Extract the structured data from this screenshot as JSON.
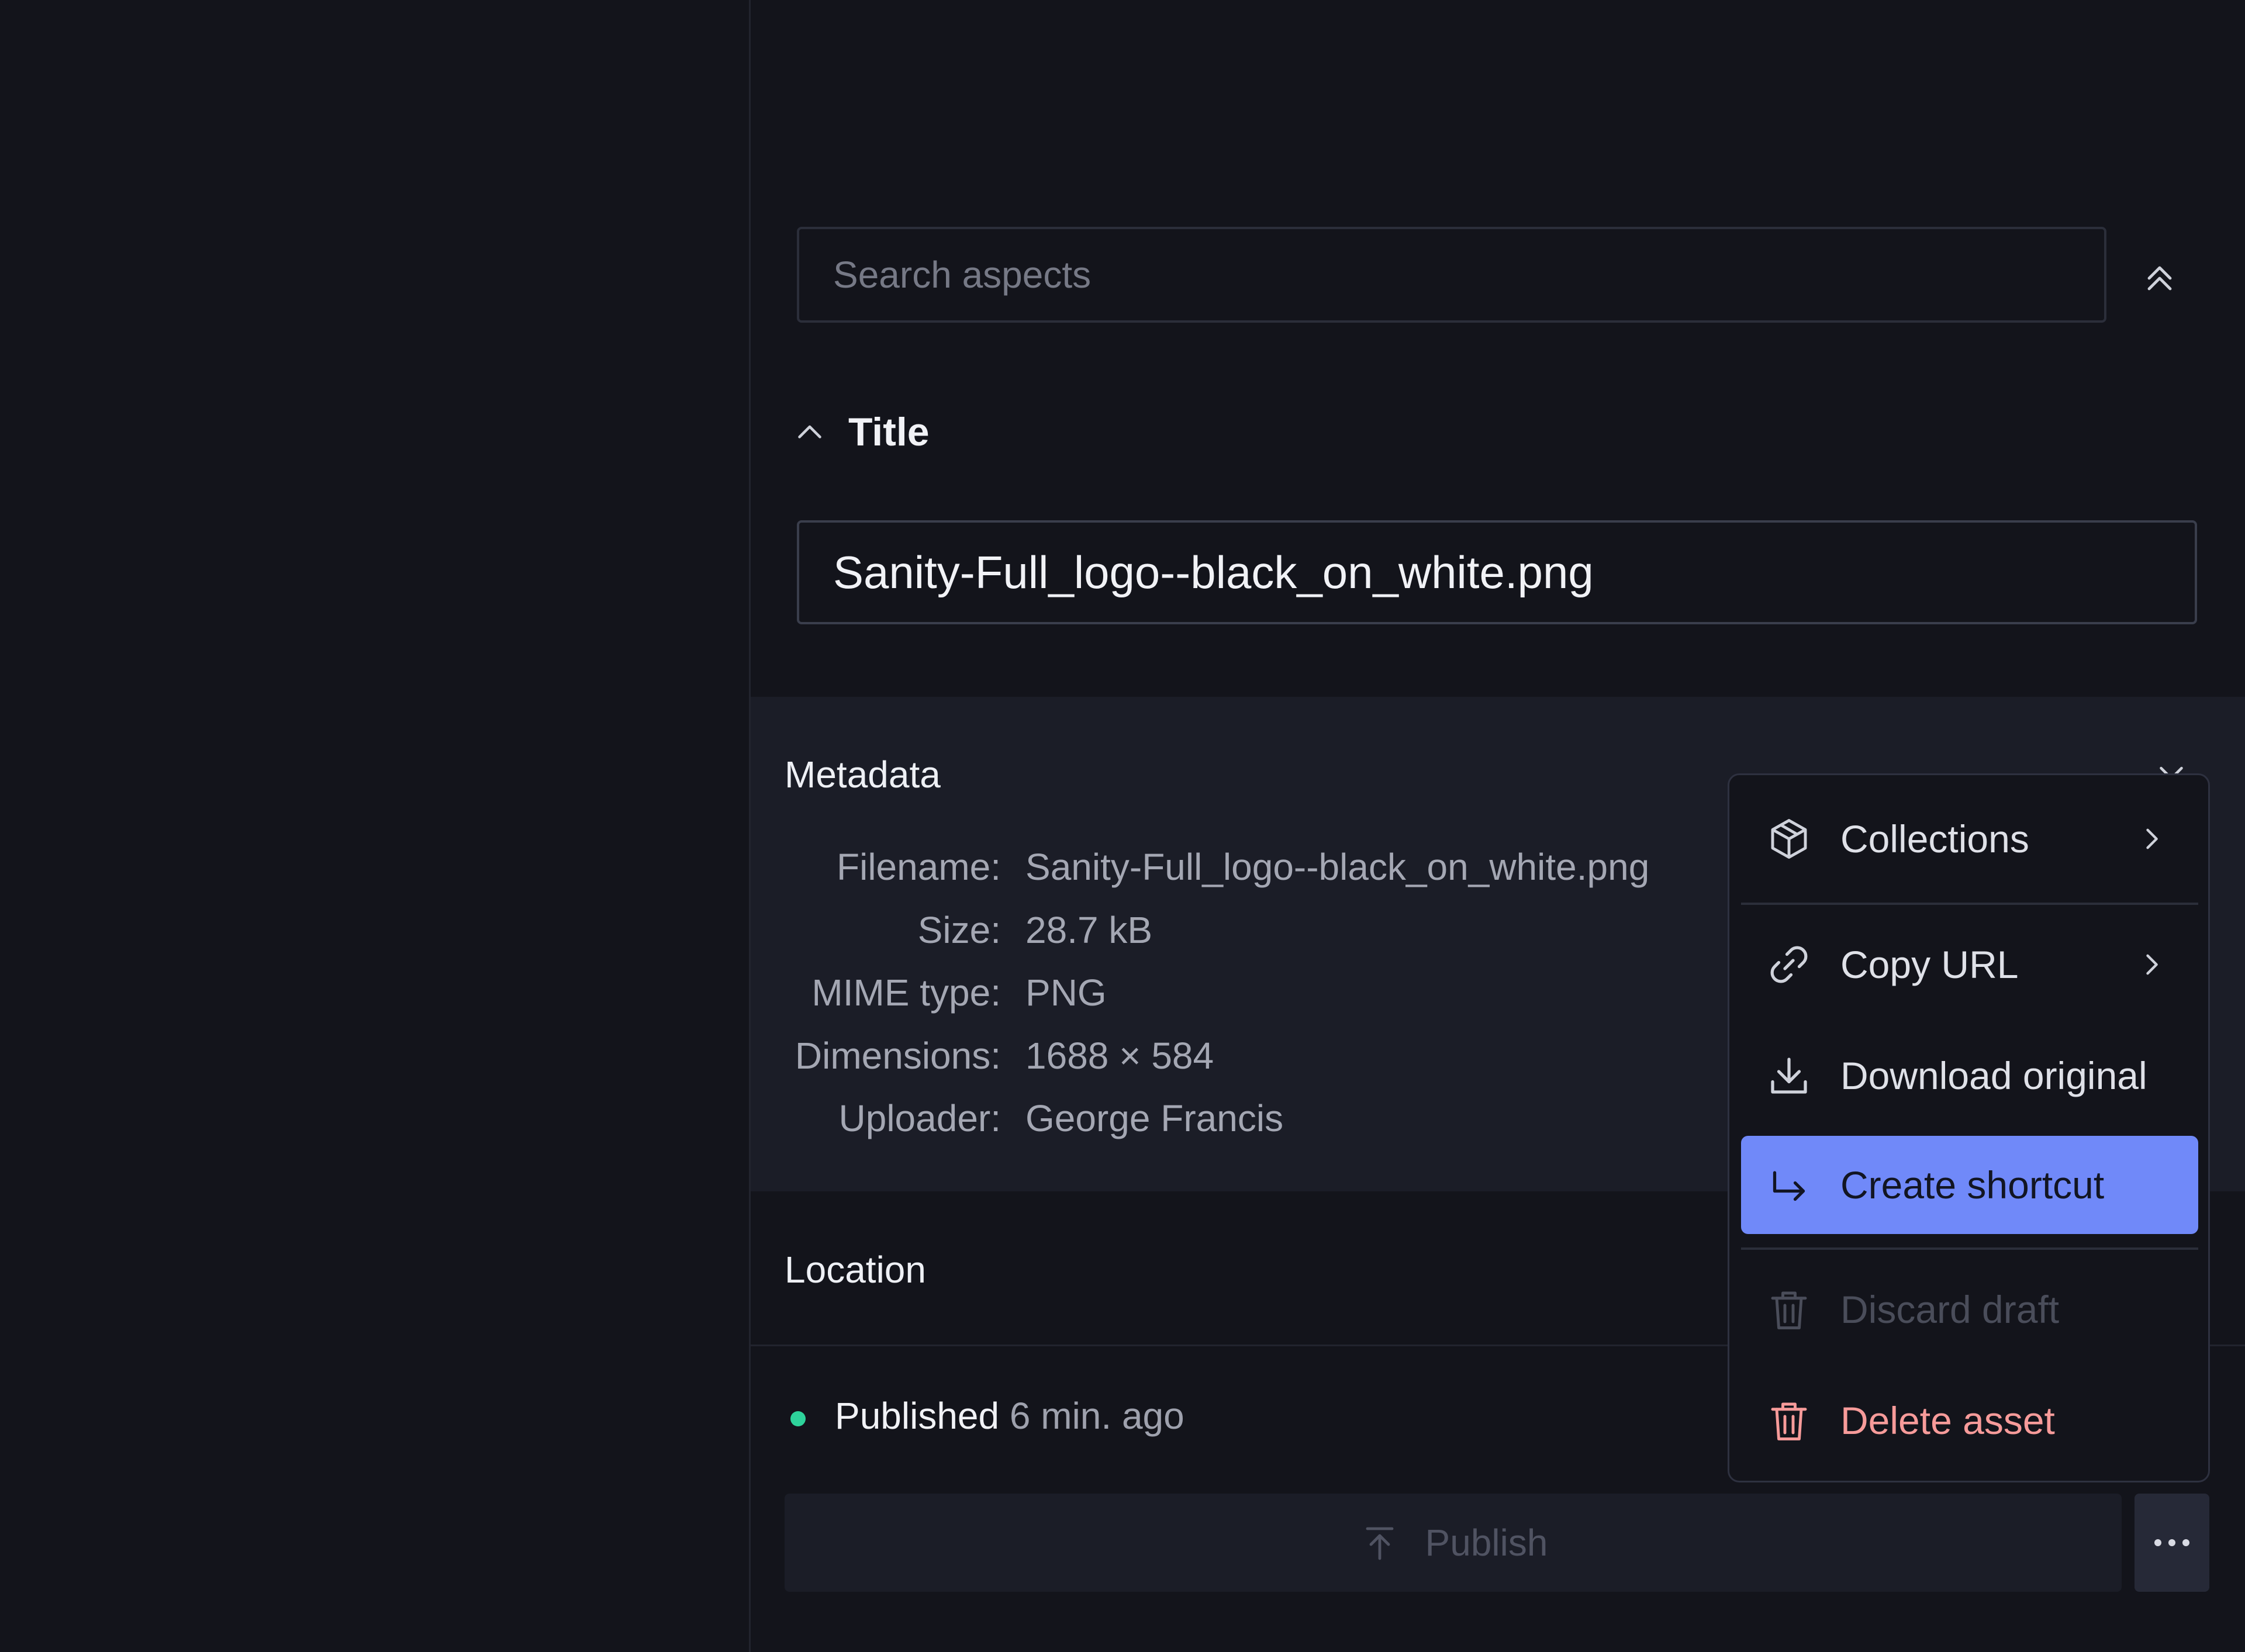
{
  "search": {
    "placeholder": "Search aspects"
  },
  "title_section": {
    "heading": "Title",
    "value": "Sanity-Full_logo--black_on_white.png"
  },
  "metadata": {
    "heading": "Metadata",
    "rows": [
      {
        "key": "Filename:",
        "value": "Sanity-Full_logo--black_on_white.png"
      },
      {
        "key": "Size:",
        "value": "28.7 kB"
      },
      {
        "key": "MIME type:",
        "value": "PNG"
      },
      {
        "key": "Dimensions:",
        "value": "1688 × 584"
      },
      {
        "key": "Uploader:",
        "value": "George Francis"
      }
    ]
  },
  "location": {
    "heading": "Location"
  },
  "status": {
    "label": "Published",
    "time": "6 min. ago",
    "color": "#2ed39b"
  },
  "publish": {
    "label": "Publish"
  },
  "menu": {
    "items": [
      {
        "label": "Collections",
        "icon": "package-icon",
        "has_submenu": true
      },
      {
        "label": "Copy URL",
        "icon": "link-icon",
        "has_submenu": true
      },
      {
        "label": "Download original",
        "icon": "download-icon"
      },
      {
        "label": "Create shortcut",
        "icon": "arrow-return-icon",
        "state": "highlighted"
      },
      {
        "label": "Discard draft",
        "icon": "trash-icon",
        "state": "disabled"
      },
      {
        "label": "Delete asset",
        "icon": "trash-icon",
        "state": "danger"
      }
    ]
  },
  "colors": {
    "background": "#13141b",
    "metadata_bg": "#1b1d27",
    "accent": "#7089f9",
    "danger": "#f79b9a",
    "published": "#2ed39b"
  }
}
